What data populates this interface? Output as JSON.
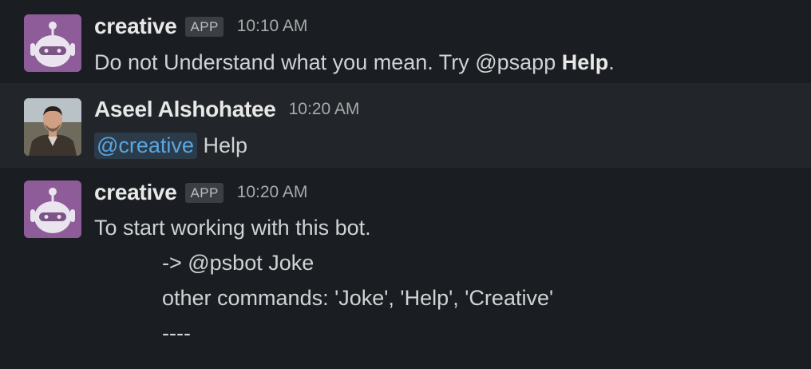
{
  "messages": [
    {
      "sender": "creative",
      "badge": "APP",
      "time": "10:10 AM",
      "avatar_icon": "robot-icon",
      "text_prefix": "Do not Understand what you mean. Try @psapp ",
      "text_bold": "Help",
      "text_suffix": "."
    },
    {
      "sender": "Aseel Alshohatee",
      "time": "10:20 AM",
      "avatar_icon": "user-photo",
      "mention": "@creative",
      "text_after_mention": " Help"
    },
    {
      "sender": "creative",
      "badge": "APP",
      "time": "10:20 AM",
      "avatar_icon": "robot-icon",
      "lines": [
        "To start working with this bot.",
        "-> @psbot Joke",
        "other commands: 'Joke', 'Help', 'Creative'",
        "----"
      ]
    }
  ],
  "colors": {
    "background": "#1a1d21",
    "hover_row": "#222529",
    "bot_avatar": "#8e5c98",
    "mention_text": "#5aa6e0",
    "mention_bg": "#2b3b4a"
  }
}
